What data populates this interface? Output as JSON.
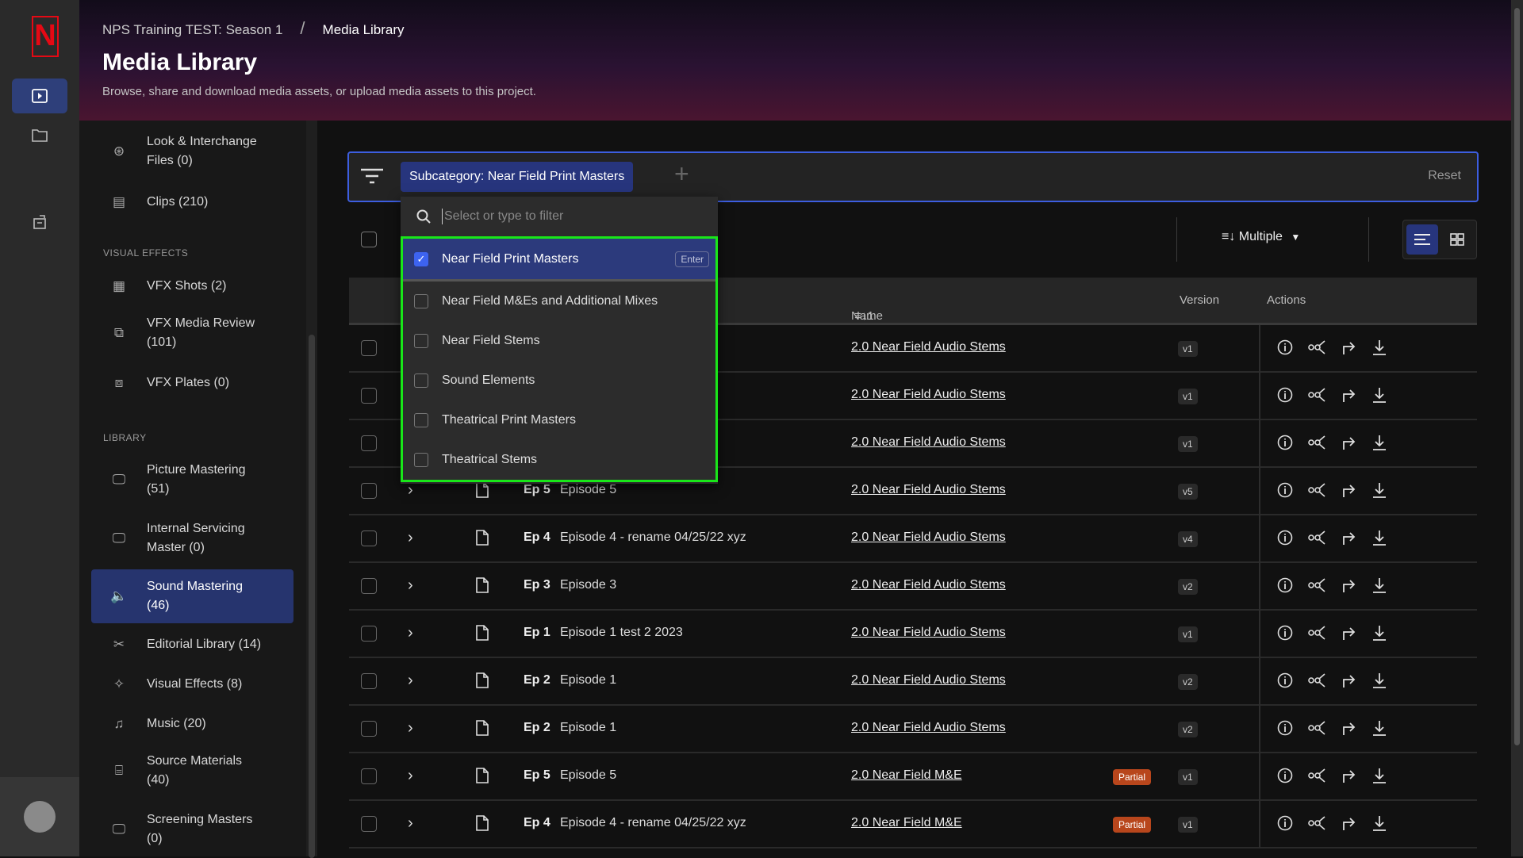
{
  "rail": {
    "logo": "N",
    "items": [
      "media-library",
      "folder",
      "transfers"
    ]
  },
  "header": {
    "breadcrumb": [
      "NPS Training TEST: Season 1",
      "Media Library"
    ],
    "separator": "/",
    "title": "Media Library",
    "subtitle": "Browse, share and download media assets, or upload media assets to this project."
  },
  "sidebar": {
    "sections": [
      "VISUAL EFFECTS",
      "LIBRARY"
    ],
    "items": [
      {
        "label": "Look & Interchange",
        "label2": "Files (0)"
      },
      {
        "label": "Clips (210)",
        "label2": ""
      },
      {
        "label": "VFX Shots (2)",
        "label2": ""
      },
      {
        "label": "VFX Media Review",
        "label2": "(101)"
      },
      {
        "label": "VFX Plates (0)",
        "label2": ""
      },
      {
        "label": "Picture Mastering",
        "label2": "(51)"
      },
      {
        "label": "Internal Servicing",
        "label2": "Master (0)"
      },
      {
        "label": "Sound Mastering",
        "label2": "(46)",
        "active": true
      },
      {
        "label": "Editorial Library (14)",
        "label2": ""
      },
      {
        "label": "Visual Effects (8)",
        "label2": ""
      },
      {
        "label": "Music (20)",
        "label2": ""
      },
      {
        "label": "Source Materials",
        "label2": "(40)"
      },
      {
        "label": "Screening Masters",
        "label2": "(0)"
      }
    ]
  },
  "filter": {
    "chip": "Subcategory: Near Field Print Masters",
    "add": "+",
    "reset": "Reset"
  },
  "dropdown": {
    "placeholder": "Select or type to filter",
    "enter_hint": "Enter",
    "options": [
      {
        "label": "Near Field Print Masters",
        "checked": true
      },
      {
        "label": "Near Field M&Es and Additional Mixes",
        "checked": false
      },
      {
        "label": "Near Field Stems",
        "checked": false
      },
      {
        "label": "Sound Elements",
        "checked": false
      },
      {
        "label": "Theatrical Print Masters",
        "checked": false
      },
      {
        "label": "Theatrical Stems",
        "checked": false
      }
    ]
  },
  "toolbar": {
    "sort": "≡↓ Multiple",
    "sort_caret": "▼"
  },
  "table": {
    "columns": {
      "name": "Name",
      "name_sort": "≡↓1",
      "version": "Version",
      "actions": "Actions"
    },
    "rows": [
      {
        "ep": "",
        "title": "",
        "name": "2.0 Near Field Audio Stems",
        "version": "v1",
        "badge": ""
      },
      {
        "ep": "",
        "title": "",
        "name": "2.0 Near Field Audio Stems",
        "version": "v1",
        "badge": ""
      },
      {
        "ep": "",
        "title": "",
        "name": "2.0 Near Field Audio Stems",
        "version": "v1",
        "badge": ""
      },
      {
        "ep": "Ep 5",
        "title": "Episode 5",
        "name": "2.0 Near Field Audio Stems",
        "version": "v5",
        "badge": ""
      },
      {
        "ep": "Ep 4",
        "title": "Episode 4 - rename 04/25/22 xyz",
        "name": "2.0 Near Field Audio Stems",
        "version": "v4",
        "badge": ""
      },
      {
        "ep": "Ep 3",
        "title": "Episode 3",
        "name": "2.0 Near Field Audio Stems",
        "version": "v2",
        "badge": ""
      },
      {
        "ep": "Ep 1",
        "title": "Episode 1 test 2 2023",
        "name": "2.0 Near Field Audio Stems",
        "version": "v1",
        "badge": ""
      },
      {
        "ep": "Ep 2",
        "title": "Episode 1",
        "name": "2.0 Near Field Audio Stems",
        "version": "v2",
        "badge": ""
      },
      {
        "ep": "Ep 2",
        "title": "Episode 1",
        "name": "2.0 Near Field Audio Stems",
        "version": "v2",
        "badge": ""
      },
      {
        "ep": "Ep 5",
        "title": "Episode 5",
        "name": "2.0 Near Field M&E",
        "version": "v1",
        "badge": "Partial"
      },
      {
        "ep": "Ep 4",
        "title": "Episode 4 - rename 04/25/22 xyz",
        "name": "2.0 Near Field M&E",
        "version": "v1",
        "badge": "Partial"
      }
    ]
  },
  "colors": {
    "accent": "#3d5ee0",
    "selected": "#27357d",
    "highlight_box": "#19e619",
    "partial": "#b8461c",
    "brand": "#e50914"
  }
}
